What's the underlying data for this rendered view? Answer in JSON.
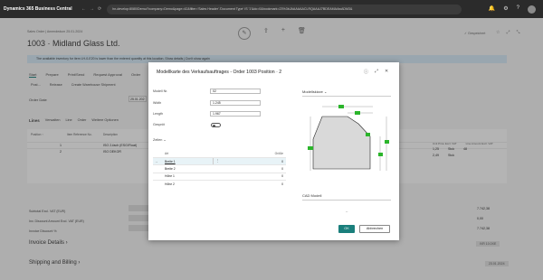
{
  "browser": {
    "app_title": "Dynamics 365 Business Central",
    "url": "hn-develop:8080/Demo/?company=Demo&page=42&filter='Sales Header'.'Document Type' IS '1'&dc=0&bookmark=23%3bJAAAAAACLRQAAAJ7BDEAMAAwADM3&",
    "nav": [
      "←",
      "→",
      "⟳"
    ],
    "icons": [
      "bell-icon",
      "gear-icon",
      "question-icon"
    ]
  },
  "page": {
    "breadcrumb": "Sales Order | Amendedum 25.01.2024",
    "title": "1003 · Midland Glass Ltd.",
    "saved": "✓ Gespeichert",
    "info_bar": "The available inventory for item LH-0-E20 is lower than the entered quantity at this location.   Show details  |  Don't show again",
    "action_tabs": [
      "Start",
      "Prepare",
      "Print/Send",
      "Request Approval",
      "Order"
    ],
    "action_row": [
      "Post...",
      "Release",
      "Create Warehouse Shipment"
    ],
    "order_date_label": "Order Date",
    "order_date_value": "25.01.202",
    "lines_tabs": [
      "Lines",
      "Verwalten",
      "Line",
      "Order",
      "Weitere Optionen"
    ],
    "lines_headers": [
      "Position ↑",
      "Item Reference No.",
      "Description"
    ],
    "lines_rows": [
      {
        "pos": "1",
        "desc": "ISO 2-fach (ESG/Float)"
      },
      {
        "pos": "2",
        "desc": "ISO DEKOR"
      }
    ],
    "lines_right_headers": [
      "Unit Price Excl. VAT",
      "Line Amount Excl. VAT"
    ],
    "lines_right_rows": [
      {
        "price": "1,25",
        "unit": "Stck",
        "qty": "48"
      },
      {
        "price": "2,49",
        "unit": "Stck",
        "qty": ""
      }
    ],
    "totals": [
      {
        "label": "Subtotal Excl. VAT (EUR)",
        "value": "7.742,38"
      },
      {
        "label": "Inv. Discount Amount Excl. VAT (EUR)",
        "value": "0,00"
      },
      {
        "label": "Invoice Discount %",
        "value": "7.742,38"
      }
    ],
    "sections": [
      {
        "title": "Invoice Details ›",
        "right": "IVR   10.0XE"
      },
      {
        "title": "Shipping and Billing ›",
        "right": "23.01.2024"
      }
    ]
  },
  "dialog": {
    "title": "Modellkarte des Verkaufsauftrages - Order 1003 Position · 2",
    "fields": [
      {
        "label": "Modell Nr.",
        "value": "02"
      },
      {
        "label": "Width",
        "value": "1.245"
      },
      {
        "label": "Length",
        "value": "1.967"
      }
    ],
    "toggle_label": "Gespröt",
    "zeilen_label": "Zeilen ⌄",
    "grid_headers": {
      "art": "Art",
      "value": "Größe"
    },
    "grid_rows": [
      {
        "art": "Breite 1",
        "value": "0",
        "selected": true
      },
      {
        "art": "Breite 2",
        "value": "0",
        "selected": false
      },
      {
        "art": "Höhe 1",
        "value": "0",
        "selected": false
      },
      {
        "art": "Höhe 2",
        "value": "0",
        "selected": false
      }
    ],
    "skizze_label": "Modellskizze ⌄",
    "cad_label": "CAD Modell",
    "cad_placeholder": "–",
    "ok_label": "OK",
    "cancel_label": "Abbrechen",
    "title_icons": [
      "info-icon",
      "expand-icon",
      "close-icon"
    ],
    "accent_color": "#1a7f7c",
    "marker_color": "#2bb52b"
  }
}
